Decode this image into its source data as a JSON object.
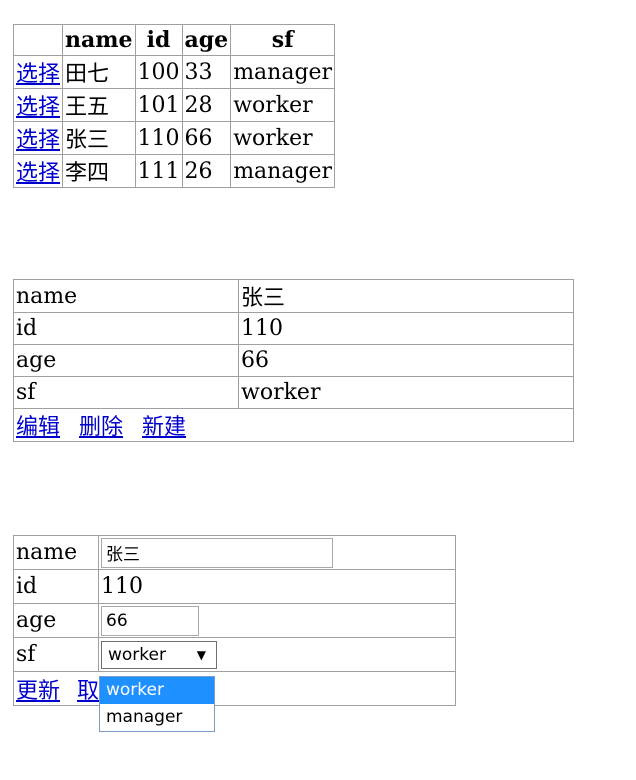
{
  "grid": {
    "headers": [
      "",
      "name",
      "id",
      "age",
      "sf"
    ],
    "select_label": "选择",
    "rows": [
      {
        "name": "田七",
        "id": "100",
        "age": "33",
        "sf": "manager"
      },
      {
        "name": "王五",
        "id": "101",
        "age": "28",
        "sf": "worker"
      },
      {
        "name": "张三",
        "id": "110",
        "age": "66",
        "sf": "worker"
      },
      {
        "name": "李四",
        "id": "111",
        "age": "26",
        "sf": "manager"
      }
    ]
  },
  "detail": {
    "fields": [
      {
        "label": "name",
        "value": "张三"
      },
      {
        "label": "id",
        "value": "110"
      },
      {
        "label": "age",
        "value": "66"
      },
      {
        "label": "sf",
        "value": "worker"
      }
    ],
    "actions": {
      "edit": "编辑",
      "delete": "删除",
      "new": "新建"
    }
  },
  "editor": {
    "labels": {
      "name": "name",
      "id": "id",
      "age": "age",
      "sf": "sf"
    },
    "name_value": "张三",
    "id_value": "110",
    "age_value": "66",
    "sf_selected": "worker",
    "sf_options": [
      "worker",
      "manager"
    ],
    "actions": {
      "update": "更新",
      "cancel": "取"
    }
  }
}
